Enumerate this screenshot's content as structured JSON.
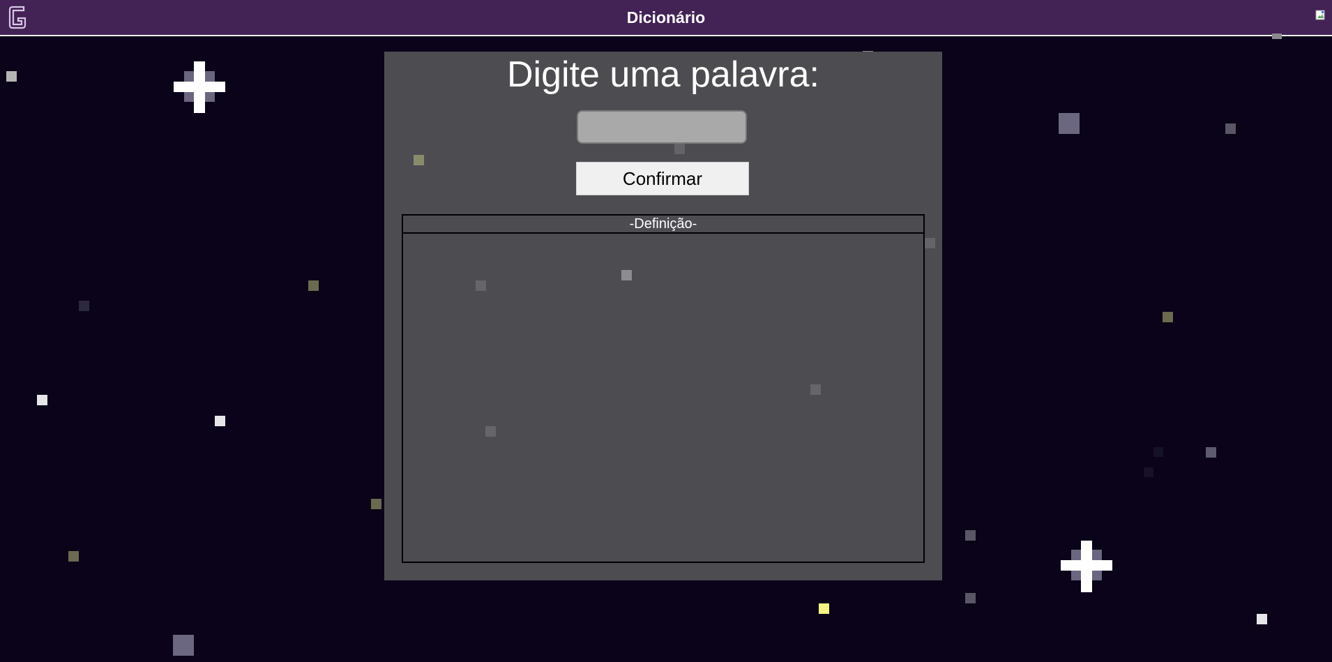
{
  "header": {
    "title": "Dicionário",
    "logo_icon": "g-logo-icon",
    "image_icon": "broken-image-icon",
    "background_color": "#432255"
  },
  "main": {
    "heading": "Digite uma palavra:",
    "word_input": {
      "value": "",
      "placeholder": ""
    },
    "confirm_label": "Confirmar",
    "definition": {
      "header": "-Definição-",
      "text": ""
    },
    "panel_color": "#4d4c51"
  },
  "background": {
    "color": "#0a0319",
    "decoration": "pixel-starfield"
  }
}
